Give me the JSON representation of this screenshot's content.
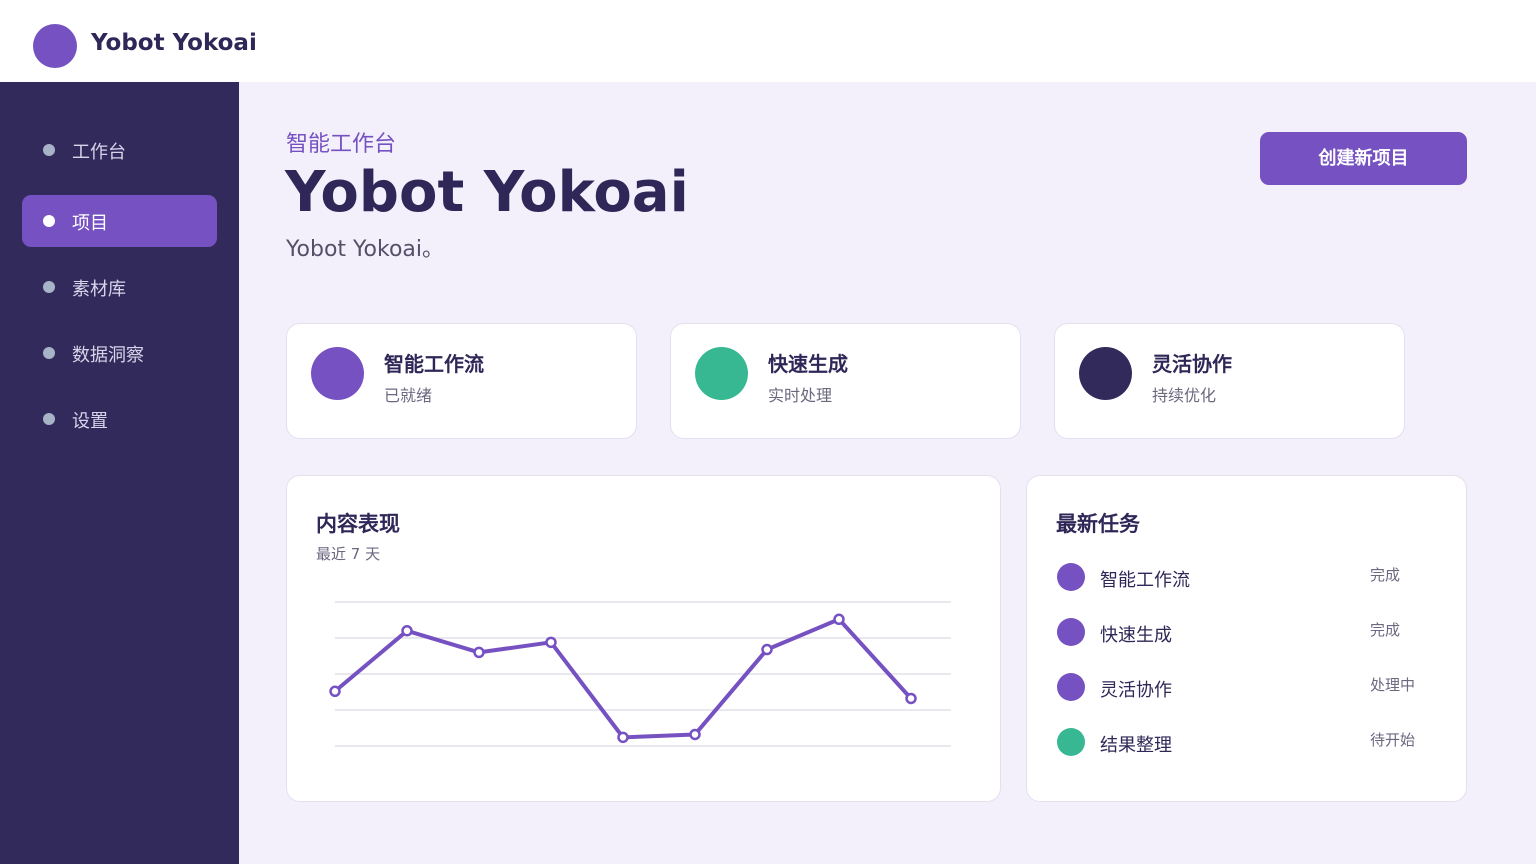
{
  "brand": {
    "name": "Yobot Yokoai",
    "logo_color": "#7651c2"
  },
  "sidebar": {
    "items": [
      {
        "label": "工作台",
        "active": false
      },
      {
        "label": "项目",
        "active": true
      },
      {
        "label": "素材库",
        "active": false
      },
      {
        "label": "数据洞察",
        "active": false
      },
      {
        "label": "设置",
        "active": false
      }
    ]
  },
  "hero": {
    "kicker": "智能工作台",
    "title": "Yobot Yokoai",
    "subtitle": "Yobot Yokoai。",
    "create_button": "创建新项目"
  },
  "stats": [
    {
      "title": "智能工作流",
      "subtitle": "已就绪",
      "color": "#7651c2"
    },
    {
      "title": "快速生成",
      "subtitle": "实时处理",
      "color": "#37b893"
    },
    {
      "title": "灵活协作",
      "subtitle": "持续优化",
      "color": "#332a5c"
    }
  ],
  "performance": {
    "title": "内容表现",
    "subtitle": "最近 7 天"
  },
  "chart_data": {
    "type": "line",
    "title": "内容表现",
    "subtitle": "最近 7 天",
    "values": [
      38,
      80,
      65,
      72,
      6,
      8,
      67,
      88,
      33
    ],
    "ylim": [
      0,
      100
    ],
    "grid": true,
    "color": "#7651c2"
  },
  "tasks": {
    "title": "最新任务",
    "items": [
      {
        "name": "智能工作流",
        "status": "完成",
        "color": "#7651c2"
      },
      {
        "name": "快速生成",
        "status": "完成",
        "color": "#7651c2"
      },
      {
        "name": "灵活协作",
        "status": "处理中",
        "color": "#7651c2"
      },
      {
        "name": "结果整理",
        "status": "待开始",
        "color": "#37b893"
      }
    ]
  }
}
